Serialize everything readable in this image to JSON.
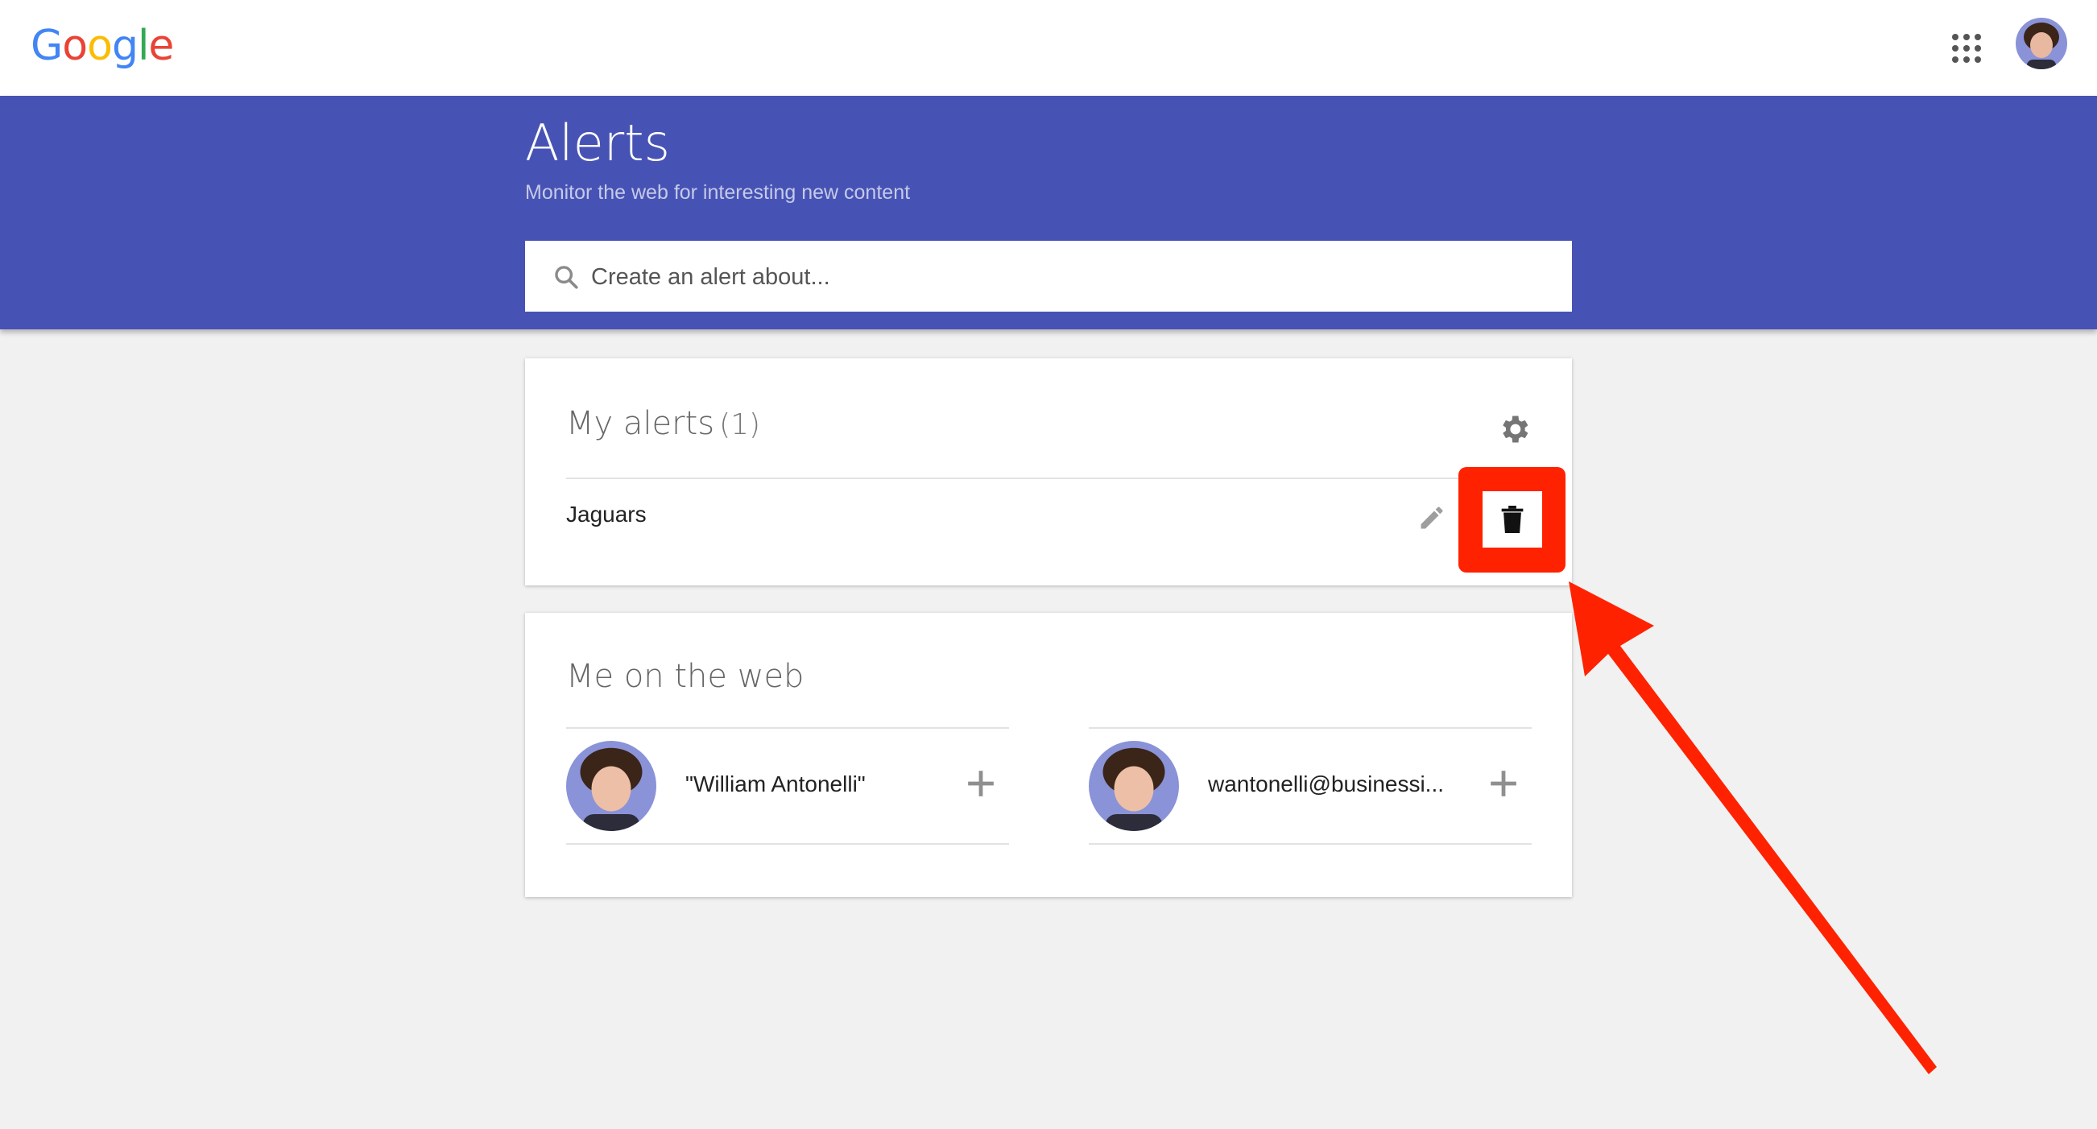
{
  "header": {
    "logo": [
      "G",
      "o",
      "o",
      "g",
      "l",
      "e"
    ],
    "logo_colors": [
      "#4285f4",
      "#ea4335",
      "#fbbc05",
      "#4285f4",
      "#34a853",
      "#ea4335"
    ]
  },
  "banner": {
    "title": "Alerts",
    "subtitle": "Monitor the web for interesting new content"
  },
  "search": {
    "placeholder": "Create an alert about..."
  },
  "my_alerts": {
    "title": "My alerts",
    "count": "(1)",
    "items": [
      {
        "label": "Jaguars"
      }
    ]
  },
  "me_on_web": {
    "title": "Me on the web",
    "items": [
      {
        "label": "\"William Antonelli\""
      },
      {
        "label": "wantonelli@businessi..."
      }
    ]
  },
  "colors": {
    "banner": "#4753b4",
    "highlight": "#ff2200"
  }
}
